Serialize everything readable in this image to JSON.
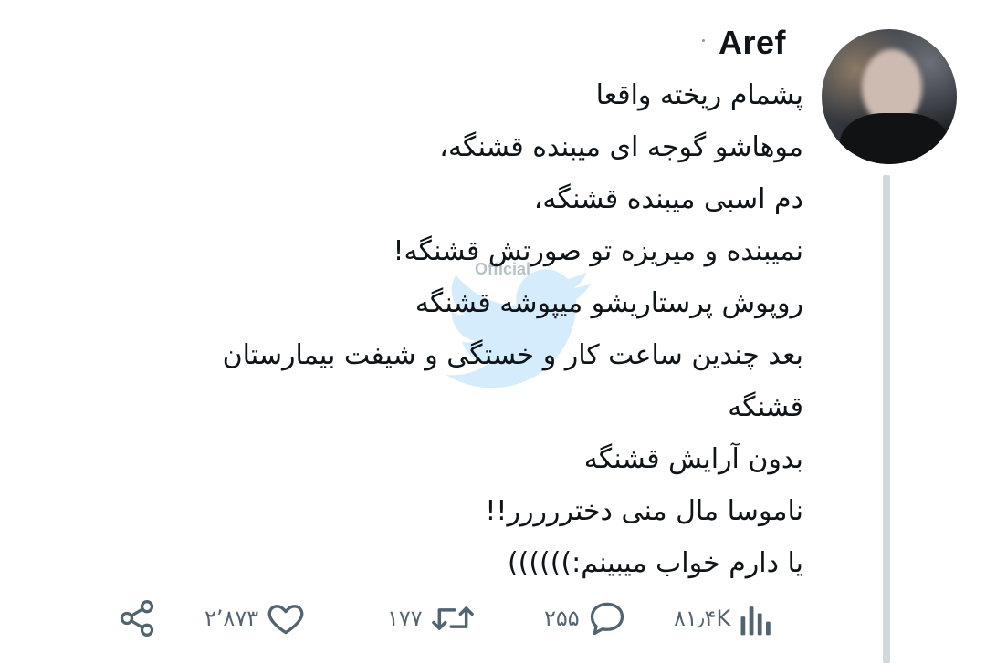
{
  "tweet": {
    "author": {
      "display_name": "Aref"
    },
    "lines": [
      "پشمام ریخته واقعا",
      "موهاشو گوجه ای میبنده قشنگه،",
      " دم اسبی میبنده قشنگه،",
      " نمیبنده و میریزه تو صورتش قشنگه!",
      "روپوش پرستاریشو میپوشه قشنگه",
      "بعد چندین ساعت کار و خستگی و شیفت بیمارستان",
      "قشنگه",
      "بدون آرایش قشنگه",
      "ناموسا مال منی دختررررر!!",
      "یا دارم خواب میبینم:))))))"
    ],
    "watermark_text": "Official",
    "stats": {
      "views": "۸۱٫۴K",
      "replies": "۲۵۵",
      "retweets": "۱۷۷",
      "likes": "۲٬۸۷۳"
    }
  },
  "icons": {
    "share": "share-icon",
    "like": "heart-icon",
    "retweet": "retweet-icon",
    "reply": "reply-icon",
    "views": "analytics-icon"
  },
  "colors": {
    "text": "#0f1419",
    "muted": "#536471",
    "thread_line": "#cfd9de"
  }
}
